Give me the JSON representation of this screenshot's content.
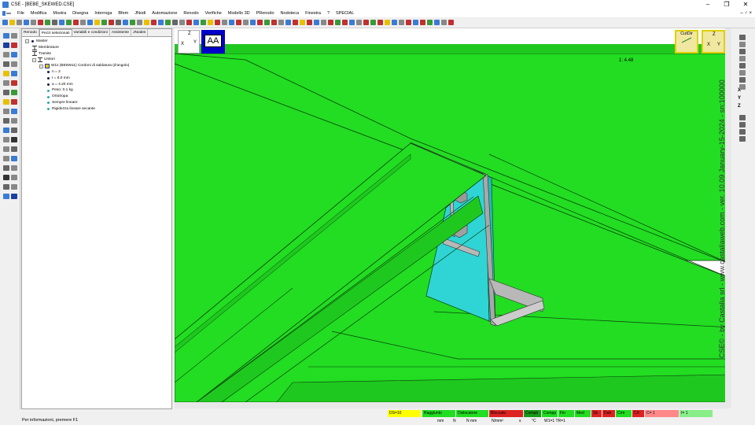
{
  "window": {
    "title": "CSE - [BEBE_SKEWED.CSE]",
    "controls": [
      "–",
      "❐",
      "✕"
    ]
  },
  "menu": {
    "items": [
      "File",
      "Modifica",
      "Mostra",
      "Disegna",
      "Interroga",
      "Bfem",
      "JNodi",
      "Automazione",
      "Renodo",
      "Verifiche",
      "Modello 3D",
      "PRenodo",
      "Nodoteca",
      "Finestra",
      "?",
      "SPECIAL"
    ],
    "mdi_controls": "– ♂ ×"
  },
  "panel": {
    "tabs": [
      "Renodo",
      "Pezzi selezionati",
      "Variabili e condizioni",
      "Assistente",
      "JNodes"
    ],
    "active_tab": "Pezzi selezionati",
    "tree": [
      {
        "label": "Master",
        "level": 0,
        "expander": "⊟",
        "kind": "dot"
      },
      {
        "label": "Membrature",
        "level": 1,
        "kind": "member"
      },
      {
        "label": "Tramite",
        "level": 1,
        "kind": "member"
      },
      {
        "label": "Unitori",
        "level": 1,
        "expander": "⊟",
        "kind": "member"
      },
      {
        "label": "W11 (BE6W11)  Cordoni di saldatura (d'angolo)",
        "level": 2,
        "expander": "⊟",
        "kind": "weld"
      },
      {
        "label": "n =  2",
        "level": 3,
        "kind": "dot-dark"
      },
      {
        "label": "t =   6.0 mm",
        "level": 3,
        "kind": "dot-dark"
      },
      {
        "label": "a =    4.20 mm",
        "level": 3,
        "kind": "dot-dark"
      },
      {
        "label": "Peso:     0.1 kg",
        "level": 3,
        "kind": "dot-teal"
      },
      {
        "label": "Ortotropa",
        "level": 3,
        "kind": "dot-teal"
      },
      {
        "label": "Sempre lineare",
        "level": 3,
        "kind": "dot-teal"
      },
      {
        "label": "Rigidezza lineare secante",
        "level": 3,
        "kind": "dot-teal"
      }
    ]
  },
  "viewport": {
    "scale": "1: 4.48",
    "view_label": "AA",
    "axes": {
      "z": "Z",
      "x": "X",
      "y": "Y"
    },
    "cutdir_label": "CutDir",
    "zxy": {
      "z": "Z",
      "x": "X",
      "y": "Y"
    },
    "version": "CSE© - by Castalia srl - www.castaliaweb.com - ver. 10.09 January-15-2024 - sn:100000",
    "colors": {
      "beam": "#22dd22",
      "plate": "#2fd5d5",
      "angle": "#b8b8b8",
      "edge": "#0b3d0b"
    }
  },
  "right_strip": {
    "axis_labels": [
      "X",
      "Y",
      "Z"
    ]
  },
  "status": {
    "message": "Per informazioni, premere F1",
    "chips": [
      {
        "label": "DS=10",
        "color": "#ffff00"
      },
      {
        "label": "Raggiunto",
        "color": "#22dd22"
      },
      {
        "label": "Dislocatore",
        "color": "#22dd22"
      },
      {
        "label": "Bloccato",
        "color": "#dd2222"
      },
      {
        "label": "Compb",
        "color": "#1a9a1a"
      },
      {
        "label": "Compp",
        "color": "#22dd22"
      },
      {
        "label": "Fin",
        "color": "#22dd22"
      },
      {
        "label": "Med",
        "color": "#22dd22"
      },
      {
        "label": "Sb",
        "color": "#dd2222"
      },
      {
        "label": "Dub",
        "color": "#dd2222"
      },
      {
        "label": "Crm",
        "color": "#22dd22"
      },
      {
        "label": "CX",
        "color": "#dd2222"
      },
      {
        "label": "C=  1",
        "color": "#ff8888"
      },
      {
        "label": "I=  1",
        "color": "#88ee88"
      }
    ],
    "units": [
      "mm",
      "N",
      "N mm",
      "N/mm²",
      "s",
      "°C",
      "W1=1 TR=1"
    ]
  }
}
